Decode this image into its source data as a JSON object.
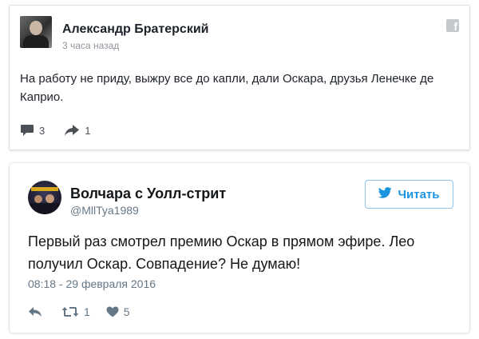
{
  "facebook_post": {
    "author": "Александр Братерский",
    "time": "3 часа назад",
    "logo_letter": "f",
    "text": "На работу не приду, выжру все до капли, дали Оскара, друзья Ленечке де Каприо.",
    "comments_count": "3",
    "shares_count": "1",
    "icons": {
      "comment": "comment-icon",
      "share": "share-arrow-icon",
      "logo": "facebook-logo-icon"
    }
  },
  "tweet": {
    "author": "Волчара с Уолл-стрит",
    "handle": "@MllTya1989",
    "follow_label": "Читать",
    "text": "Первый раз смотрел премию Оскар в прямом эфире. Лео получил Оскар. Совпадение? Не думаю!",
    "datetime": "08:18 - 29 февраля 2016",
    "retweets_count": "1",
    "likes_count": "5",
    "icons": {
      "reply": "reply-icon",
      "retweet": "retweet-icon",
      "like": "heart-icon",
      "bird": "twitter-bird-icon"
    }
  },
  "colors": {
    "twitter_blue": "#1b95e0",
    "muted_gray": "#657786",
    "facebook_gray": "#90949c"
  }
}
